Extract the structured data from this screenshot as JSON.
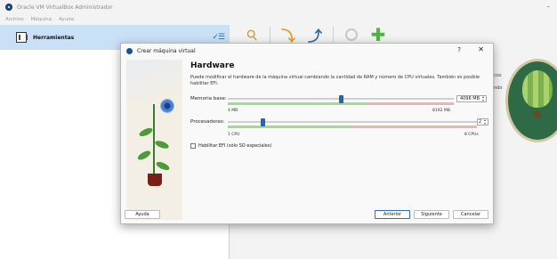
{
  "app": {
    "title": "Oracle VM VirtualBox Administrador",
    "minimize": "–",
    "menu": [
      "Archivo",
      "Máquina",
      "Ayuda"
    ]
  },
  "sidebar": {
    "tools_label": "Herramientas",
    "menu_icon": "list-menu-icon"
  },
  "toolbar": {
    "icons": [
      "wrench-icon",
      "import-icon",
      "export-icon",
      "gray-circle-icon",
      "add-plus-icon"
    ]
  },
  "background_right": {
    "line1": "ucos",
    "line2": "ando"
  },
  "dialog": {
    "title": "Crear máquina virtual",
    "help": "?",
    "close": "✕",
    "heading": "Hardware",
    "description": "Puede modificar el hardware de la máquina virtual cambiando la cantidad de RAM y número de CPU virtuales. También es posible habilitar EFI.",
    "memory": {
      "label": "Memoria base:",
      "value": "4096 MB",
      "min": "4 MB",
      "max": "8192 MB",
      "fraction": 0.5,
      "green_fraction": 0.62
    },
    "cpu": {
      "label": "Procesadores:",
      "value": "2",
      "min": "1 CPU",
      "max": "8 CPUs",
      "fraction": 0.14,
      "green_fraction": 0.5
    },
    "efi_label": "Habilitar EFI (sólo SO especiales)",
    "efi_checked": false,
    "buttons": {
      "help": "Ayuda",
      "back": "Anterior",
      "next": "Siguiente",
      "cancel": "Cancelar"
    }
  },
  "colors": {
    "accent": "#1f63c6",
    "selection": "#c9e0f7",
    "scale_green": "#9fdc8e",
    "scale_red": "#f1b2a9"
  }
}
